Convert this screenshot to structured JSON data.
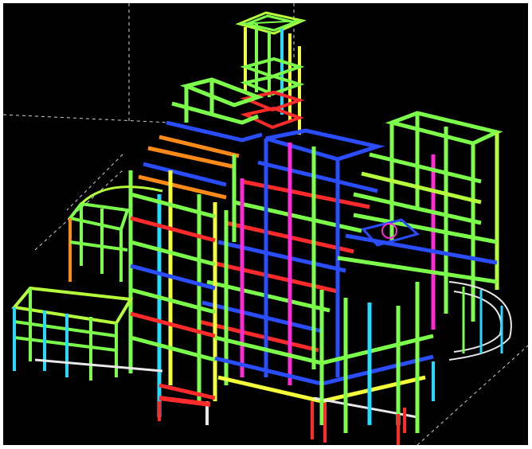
{
  "view": {
    "kind": "3d-wireframe-structural-model",
    "background": "#000000",
    "frame_color": "#ffffff"
  },
  "palette": {
    "green": "#7cff4a",
    "lime": "#b6ff3c",
    "yellow": "#f2ff3a",
    "blue": "#2a4dff",
    "cyan": "#26d9ff",
    "magenta": "#ff2bd6",
    "red": "#ff2a2a",
    "orange": "#ff8a1a",
    "white": "#e8e8e8",
    "grid": "#d0d0d0"
  },
  "components": [
    "top-tower-roof",
    "top-tower",
    "upper-left-block",
    "central-core",
    "right-tower",
    "left-annex-upper",
    "left-annex-lower",
    "right-arc-structure",
    "front-podium",
    "ground-columns"
  ]
}
